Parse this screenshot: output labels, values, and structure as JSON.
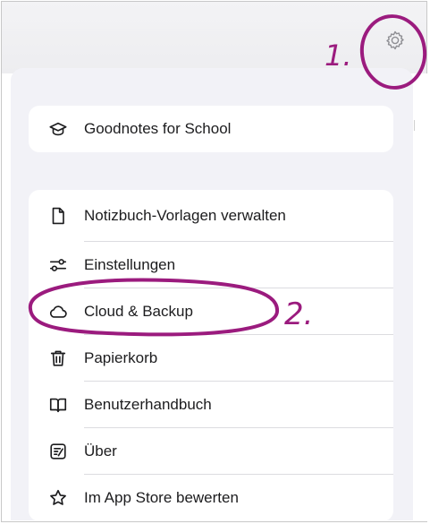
{
  "header": {
    "settings_icon": "gear-icon"
  },
  "school_card": {
    "label": "Goodnotes for School",
    "icon": "graduation-cap-icon"
  },
  "menu": {
    "items": [
      {
        "label": "Notizbuch-Vorlagen verwalten",
        "icon": "document-icon"
      },
      {
        "label": "Einstellungen",
        "icon": "sliders-icon"
      },
      {
        "label": "Cloud & Backup",
        "icon": "cloud-icon"
      },
      {
        "label": "Papierkorb",
        "icon": "trash-icon"
      },
      {
        "label": "Benutzerhandbuch",
        "icon": "book-icon"
      },
      {
        "label": "Über",
        "icon": "notepad-icon"
      },
      {
        "label": "Im App Store bewerten",
        "icon": "star-icon"
      }
    ]
  },
  "annotations": {
    "step1": "1.",
    "step2": "2.",
    "color": "#9b1b7e"
  }
}
